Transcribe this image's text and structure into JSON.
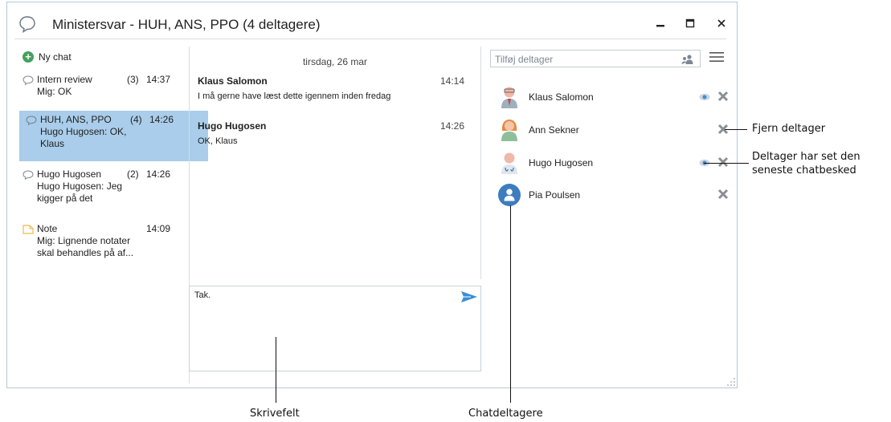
{
  "window": {
    "title": "Ministersvar - HUH, ANS, PPO (4 deltagere)"
  },
  "left": {
    "new_chat_label": "Ny chat",
    "chats": [
      {
        "title": "Intern review",
        "count": "(3)",
        "time": "14:37",
        "preview": "Mig: OK"
      },
      {
        "title": "HUH, ANS, PPO",
        "count": "(4)",
        "time": "14:26",
        "preview": "Hugo Hugosen: OK, Klaus"
      },
      {
        "title": "Hugo Hugosen",
        "count": "(2)",
        "time": "14:26",
        "preview": "Hugo Hugosen: Jeg kigger på det"
      },
      {
        "title": "Note",
        "count": "",
        "time": "14:09",
        "preview": "Mig: Lignende notater skal behandles på af..."
      }
    ]
  },
  "messages": {
    "date": "tirsdag, 26 mar",
    "items": [
      {
        "sender": "Klaus Salomon",
        "time": "14:14",
        "body": "I må gerne have læst dette igennem inden fredag"
      },
      {
        "sender": "Hugo Hugosen",
        "time": "14:26",
        "body": "OK, Klaus"
      }
    ]
  },
  "compose": {
    "value": "Tak."
  },
  "participants": {
    "add_placeholder": "Tilføj deltager",
    "list": [
      {
        "name": "Klaus Salomon",
        "seen": true
      },
      {
        "name": "Ann Sekner",
        "seen": false
      },
      {
        "name": "Hugo Hugosen",
        "seen": true
      },
      {
        "name": "Pia Poulsen",
        "seen": false
      }
    ]
  },
  "annotations": {
    "remove_participant": "Fjern deltager",
    "seen_line1": "Deltager har set den",
    "seen_line2": "seneste chatbesked",
    "compose_field": "Skrivefelt",
    "chat_participants": "Chatdeltagere"
  },
  "colors": {
    "selected_row": "#a9cdea",
    "accent_blue": "#3a8fd6",
    "new_chat_green": "#44a060",
    "note_yellow": "#f2b84a"
  }
}
